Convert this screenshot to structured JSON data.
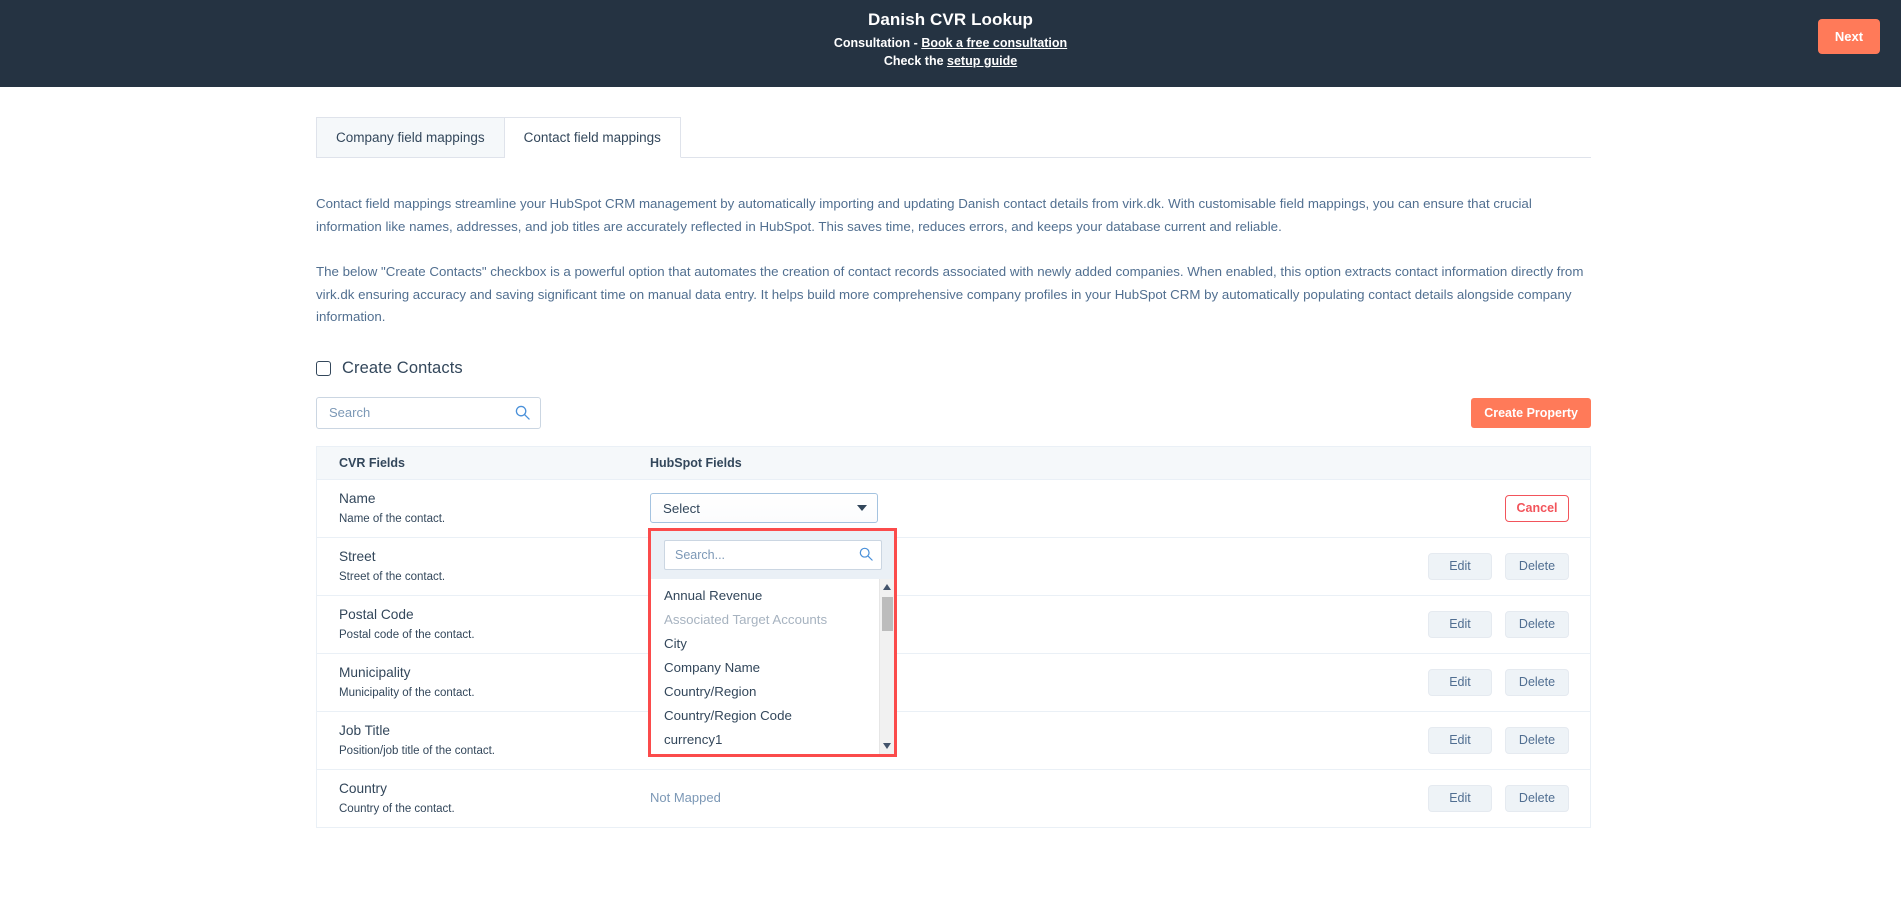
{
  "header": {
    "title": "Danish CVR Lookup",
    "consultation_prefix": "Consultation - ",
    "consultation_link": "Book a free consultation",
    "setup_prefix": "Check the ",
    "setup_link": "setup guide",
    "next_label": "Next",
    "bg_color": "#253342",
    "accent_color": "#ff7a59"
  },
  "tabs": [
    {
      "label": "Company field mappings",
      "active": false
    },
    {
      "label": "Contact field mappings",
      "active": true
    }
  ],
  "paragraphs": {
    "first": "Contact field mappings streamline your HubSpot CRM management by automatically importing and updating Danish contact details from virk.dk. With customisable field mappings, you can ensure that crucial information like names, addresses, and job titles are accurately reflected in HubSpot. This saves time, reduces errors, and keeps your database current and reliable.",
    "second": "The below \"Create Contacts\" checkbox is a powerful option that automates the creation of contact records associated with newly added companies. When enabled, this option extracts contact information directly from virk.dk ensuring accuracy and saving significant time on manual data entry. It helps build more comprehensive company profiles in your HubSpot CRM by automatically populating contact details alongside company information."
  },
  "create_contacts": {
    "label": "Create Contacts",
    "checked": false
  },
  "toolbar": {
    "search_placeholder": "Search",
    "search_value": "",
    "create_property_label": "Create Property"
  },
  "table": {
    "columns": [
      "CVR Fields",
      "HubSpot Fields"
    ],
    "not_mapped_label": "Not Mapped",
    "edit_label": "Edit",
    "delete_label": "Delete",
    "cancel_label": "Cancel",
    "rows": [
      {
        "name": "Name",
        "description": "Name of the contact.",
        "state": "editing",
        "select_value": "Select"
      },
      {
        "name": "Street",
        "description": "Street of the contact.",
        "state": "mapped_hidden"
      },
      {
        "name": "Postal Code",
        "description": "Postal code of the contact.",
        "state": "mapped_hidden"
      },
      {
        "name": "Municipality",
        "description": "Municipality of the contact.",
        "state": "mapped_hidden"
      },
      {
        "name": "Job Title",
        "description": "Position/job title of the contact.",
        "state": "mapped_hidden"
      },
      {
        "name": "Country",
        "description": "Country of the contact.",
        "state": "not_mapped"
      }
    ]
  },
  "dropdown": {
    "open": true,
    "highlight_color": "#fb4b4b",
    "search_placeholder": "Search...",
    "search_value": "",
    "options": [
      {
        "label": "Annual Revenue",
        "disabled": false
      },
      {
        "label": "Associated Target Accounts",
        "disabled": true
      },
      {
        "label": "City",
        "disabled": false
      },
      {
        "label": "Company Name",
        "disabled": false
      },
      {
        "label": "Country/Region",
        "disabled": false
      },
      {
        "label": "Country/Region Code",
        "disabled": false
      },
      {
        "label": "currency1",
        "disabled": false
      }
    ]
  }
}
